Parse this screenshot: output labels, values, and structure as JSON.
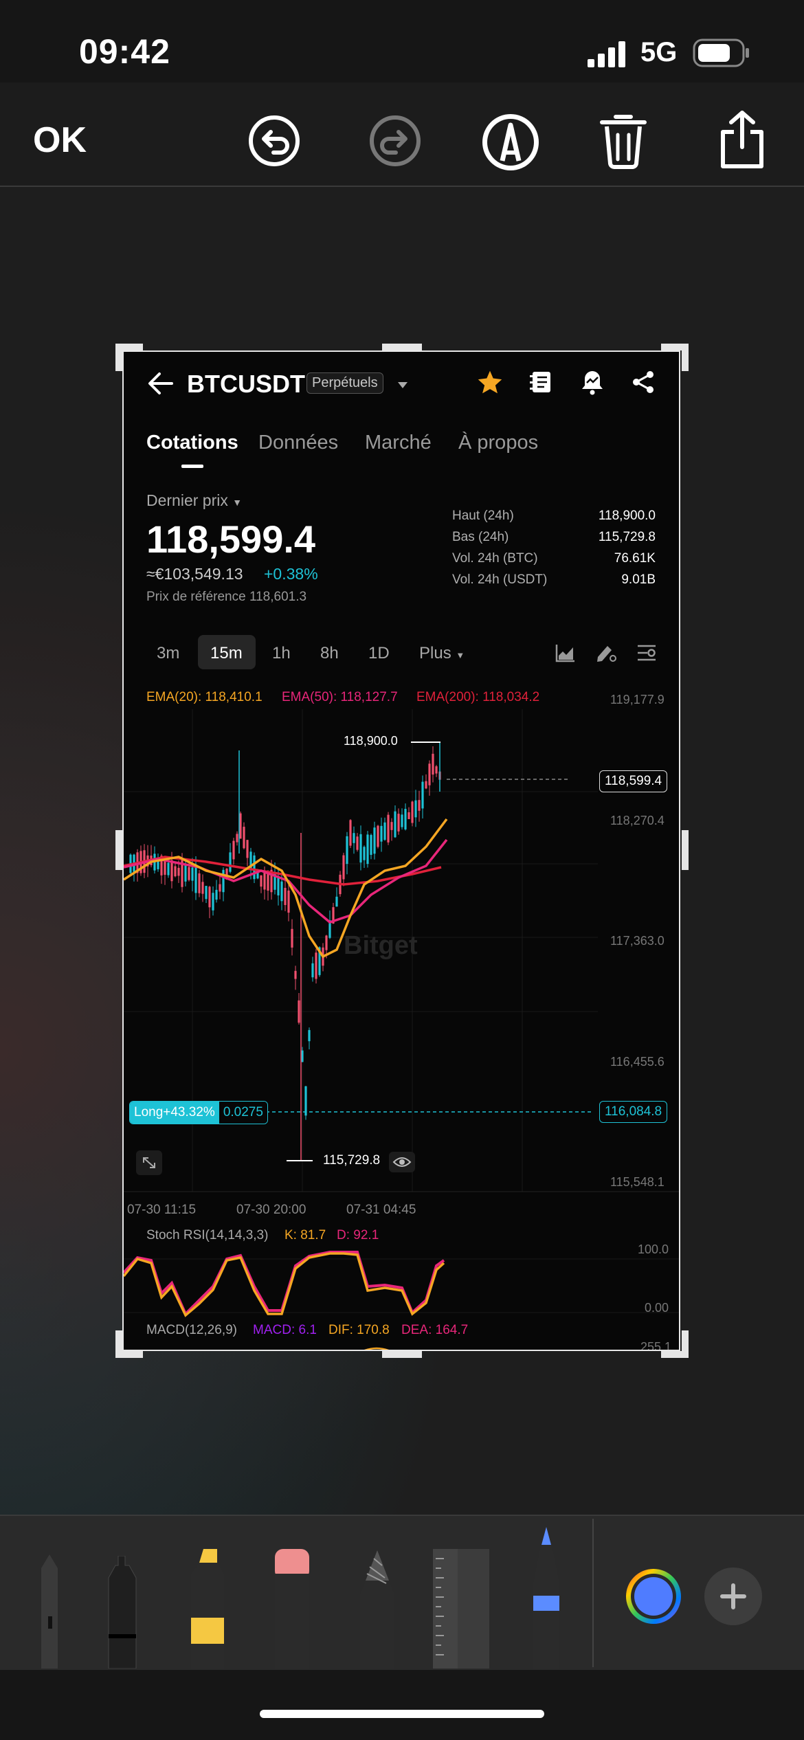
{
  "status_bar": {
    "time": "09:42",
    "network": "5G"
  },
  "toolbar": {
    "ok_label": "OK"
  },
  "app": {
    "pair": "BTCUSDT",
    "contract_type": "Perpétuels",
    "tabs": [
      "Cotations",
      "Données",
      "Marché",
      "À propos"
    ],
    "last_price_label": "Dernier prix",
    "last_price": "118,599.4",
    "eur_price": "≈€103,549.13",
    "change_pct": "+0.38%",
    "reference_price": "Prix de référence 118,601.3",
    "stats": [
      {
        "label": "Haut (24h)",
        "value": "118,900.0"
      },
      {
        "label": "Bas (24h)",
        "value": "115,729.8"
      },
      {
        "label": "Vol. 24h (BTC)",
        "value": "76.61K"
      },
      {
        "label": "Vol. 24h (USDT)",
        "value": "9.01B"
      }
    ],
    "timeframes": [
      "3m",
      "15m",
      "1h",
      "8h",
      "1D",
      "Plus"
    ],
    "selected_timeframe": "15m",
    "ema": [
      "EMA(20): 118,410.1",
      "EMA(50): 118,127.7",
      "EMA(200): 118,034.2"
    ],
    "price_axis": [
      "119,177.9",
      "118,270.4",
      "117,363.0",
      "116,455.6",
      "115,548.1"
    ],
    "current_price_tag": "118,599.4",
    "high_marker": "118,900.0",
    "low_marker": "115,729.8",
    "position": {
      "label": "Long+43.32%",
      "size": "0.0275",
      "price": "116,084.8"
    },
    "watermark": "Bitget",
    "time_axis": [
      "07-30 11:15",
      "07-30 20:00",
      "07-31 04:45"
    ],
    "stoch_rsi": {
      "name": "Stoch RSI(14,14,3,3)",
      "k": "K: 81.7",
      "d": "D: 92.1",
      "axis_top": "100.0",
      "axis_bottom": "0.00"
    },
    "macd": {
      "name": "MACD(12,26,9)",
      "macd": "MACD: 6.1",
      "dif": "DIF: 170.8",
      "dea": "DEA: 164.7",
      "axis_top": "255.1"
    }
  },
  "colors": {
    "up": "#1ec2d6",
    "down": "#f0506e",
    "ema20": "#f5a623",
    "ema50": "#e8267a",
    "ema200": "#e0213a",
    "macd": "#a020f0"
  }
}
